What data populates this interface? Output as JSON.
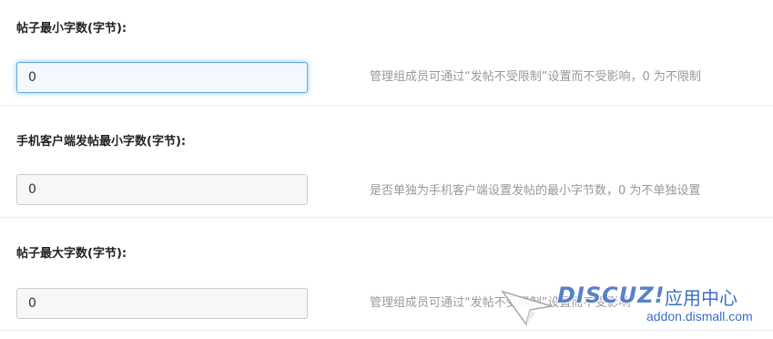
{
  "settings": [
    {
      "label": "帖子最小字数(字节):",
      "value": "0",
      "help": "管理组成员可通过“发帖不受限制”设置而不受影响，0 为不限制",
      "focused": true
    },
    {
      "label": "手机客户端发帖最小字数(字节):",
      "value": "0",
      "help": "是否单独为手机客户端设置发帖的最小字节数，0 为不单独设置",
      "focused": false
    },
    {
      "label": "帖子最大字数(字节):",
      "value": "0",
      "help": "管理组成员可通过“发帖不受限制”设置而不受影响",
      "focused": false
    }
  ],
  "watermark": {
    "brand": "DISCUZ!",
    "brand_cn": "应用中心",
    "url": "addon.dismall.com",
    "icon": "cursor-arrow-icon"
  },
  "colors": {
    "focus_border": "#66afe9",
    "help_text": "#999999",
    "watermark_blue": "#3a6fc9"
  }
}
